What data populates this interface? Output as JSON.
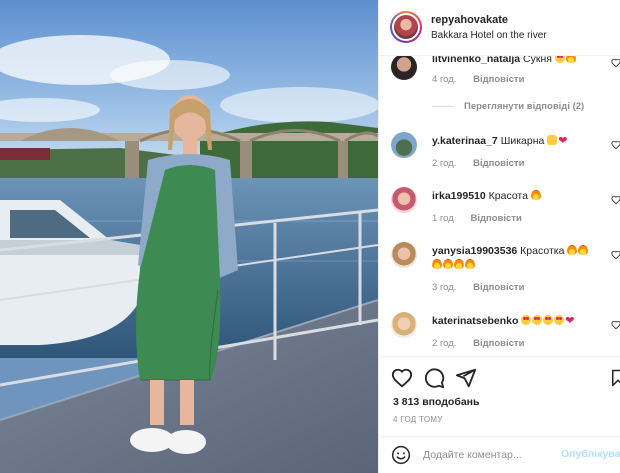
{
  "post": {
    "username": "repyahovakate",
    "location": "Bakkara Hotel on the river",
    "likes": "3 813 вподобань",
    "time": "4 ГОД ТОМУ"
  },
  "comments": [
    {
      "user": "litvinenko_natalja",
      "text": "Сукня",
      "emoji": [
        "hearteyes",
        "fire"
      ],
      "time": "4 год.",
      "reply": "Відповісти"
    },
    {
      "view_replies": "Переглянути відповіді (2)"
    },
    {
      "user": "y.katerinaa_7",
      "text": "Шикарна",
      "emoji": [
        "screamface",
        "redheart"
      ],
      "time": "2 год.",
      "reply": "Відповісти"
    },
    {
      "user": "irka199510",
      "text": "Красота",
      "emoji": [
        "fire"
      ],
      "time": "1 год",
      "reply": "Відповісти"
    },
    {
      "user": "yanysia19903536",
      "text": "Красотка",
      "emoji": [
        "fire",
        "fire",
        "fire",
        "fire",
        "fire",
        "fire"
      ],
      "time": "3 год.",
      "reply": "Відповісти"
    },
    {
      "user": "katerinatsebenko",
      "text": "",
      "emoji": [
        "hearteyes",
        "hearteyes",
        "hearteyes",
        "hearteyes",
        "redheart"
      ],
      "time": "2 год.",
      "reply": "Відповісти"
    }
  ],
  "add_comment": {
    "placeholder": "Додайте коментар...",
    "publish_label": "Опублікувати"
  },
  "icons": {
    "heart": "heart-icon",
    "comment": "comment-icon",
    "share": "paper-plane-icon",
    "save": "bookmark-icon",
    "emoji": "smiley-icon"
  },
  "colors": {
    "accent_disabled": "#b2dffc",
    "muted": "#8e8e8e",
    "text": "#262626",
    "like_red": "#e0245e"
  }
}
